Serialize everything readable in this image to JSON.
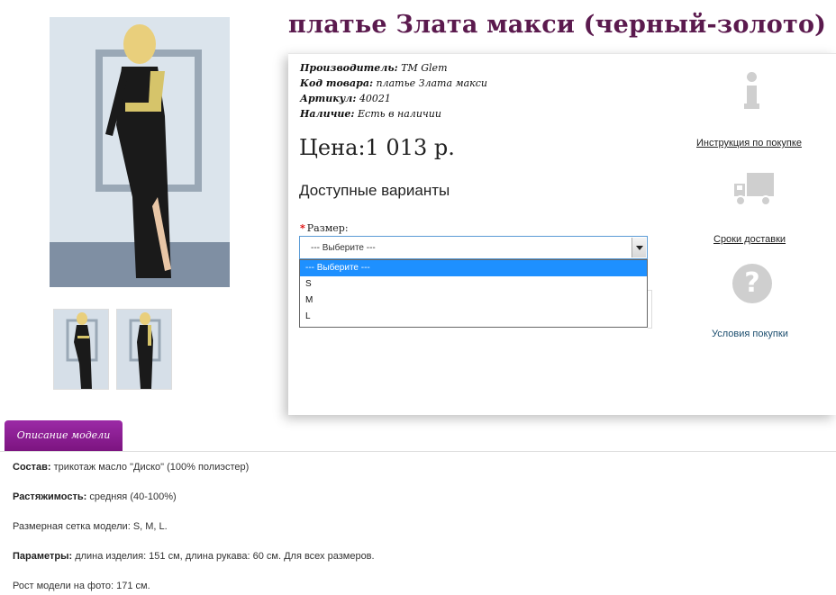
{
  "product": {
    "title": "платье Злата макси (черный-золото)",
    "manufacturer_label": "Производитель:",
    "manufacturer_value": "ТМ Glem",
    "code_label": "Код товара:",
    "code_value": "платье Злата макси",
    "sku_label": "Артикул:",
    "sku_value": "40021",
    "availability_label": "Наличие:",
    "availability_value": "Есть в наличии",
    "price": "Цена:1 013 р."
  },
  "options": {
    "title": "Доступные варианты",
    "size_label": "Размер:",
    "required_mark": "*",
    "select_value": "--- Выберите ---",
    "dropdown_options": [
      "--- Выберите ---",
      "S",
      "M",
      "L"
    ]
  },
  "side_links": {
    "instructions": "Инструкция по покупке",
    "delivery": "Сроки доставки",
    "conditions": "Условия покупки"
  },
  "icons": {
    "info": "info-icon",
    "truck": "truck-icon",
    "question": "question-icon"
  },
  "tab": {
    "label": "Описание модели"
  },
  "description": {
    "composition_label": "Состав:",
    "composition_value": "трикотаж масло \"Диско\" (100% полиэстер)",
    "stretch_label": "Растяжимость:",
    "stretch_value": "средняя (40-100%)",
    "sizes_text": "Размерная сетка модели: S, M, L.",
    "params_label": "Параметры:",
    "params_value": "длина изделия: 151 см, длина рукава: 60 см. Для всех размеров.",
    "model_height_text": "Рост модели на фото: 171 см."
  },
  "colors": {
    "title": "#5b1a4e",
    "tab": "#8a1a8f",
    "select_highlight": "#1e90ff",
    "icon_grey": "#cfcfcf"
  }
}
